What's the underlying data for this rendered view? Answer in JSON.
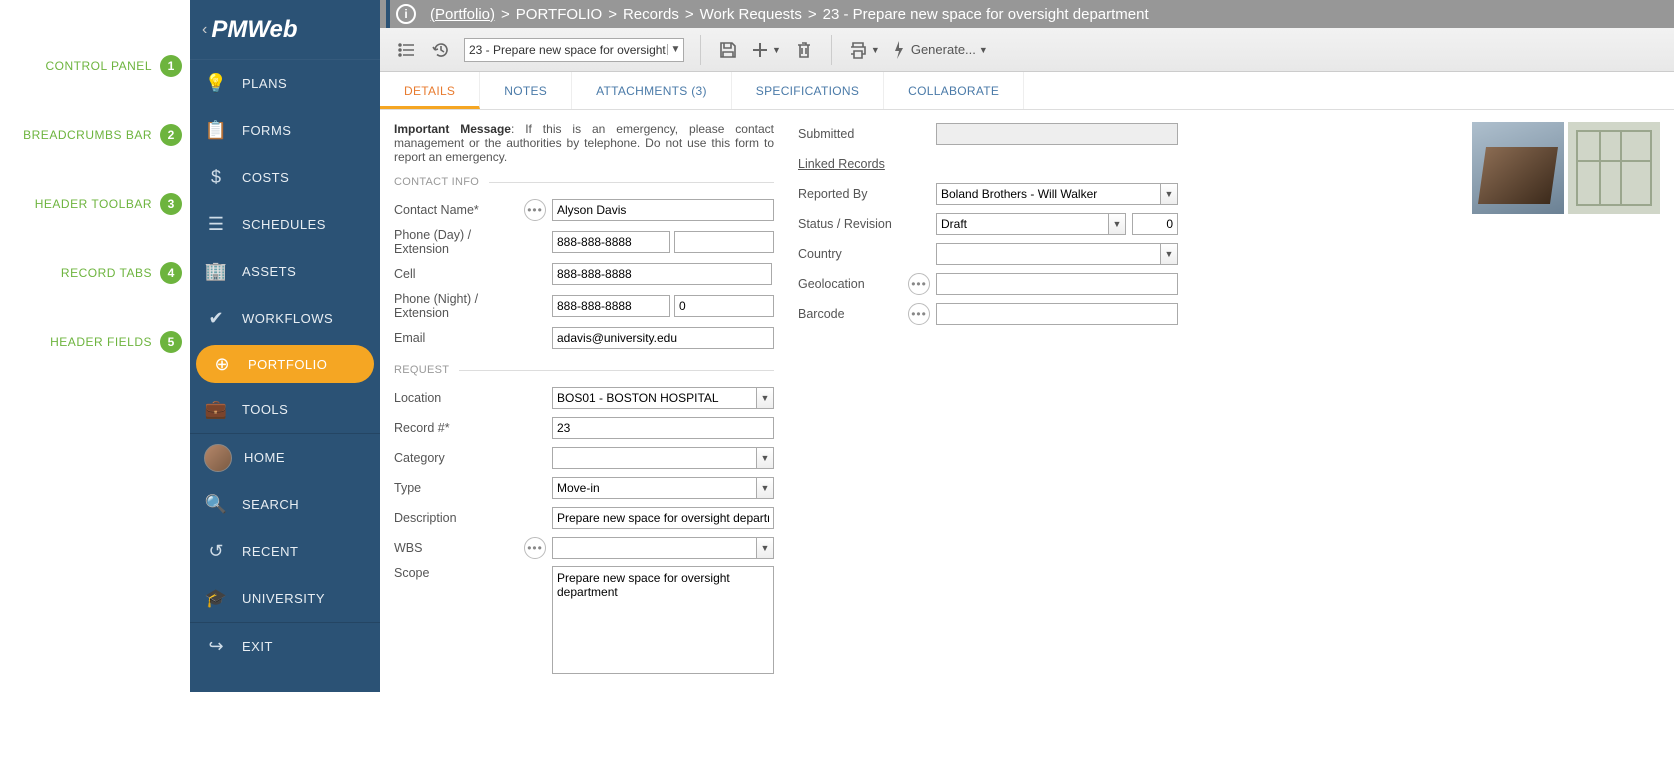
{
  "annotations": [
    {
      "num": "1",
      "label": "CONTROL PANEL"
    },
    {
      "num": "2",
      "label": "BREADCRUMBS BAR"
    },
    {
      "num": "3",
      "label": "HEADER TOOLBAR"
    },
    {
      "num": "4",
      "label": "RECORD TABS"
    },
    {
      "num": "5",
      "label": "HEADER FIELDS"
    }
  ],
  "logo_text": "PMWeb",
  "sidebar": {
    "items": [
      {
        "label": "PLANS",
        "icon": "💡"
      },
      {
        "label": "FORMS",
        "icon": "📋"
      },
      {
        "label": "COSTS",
        "icon": "$"
      },
      {
        "label": "SCHEDULES",
        "icon": "☰"
      },
      {
        "label": "ASSETS",
        "icon": "🏢"
      },
      {
        "label": "WORKFLOWS",
        "icon": "✔"
      },
      {
        "label": "PORTFOLIO",
        "icon": "⊕",
        "active": true
      },
      {
        "label": "TOOLS",
        "icon": "💼"
      }
    ],
    "secondary": [
      {
        "label": "HOME",
        "avatar": true
      },
      {
        "label": "SEARCH",
        "icon": "🔍"
      },
      {
        "label": "RECENT",
        "icon": "↺"
      },
      {
        "label": "UNIVERSITY",
        "icon": "🎓"
      }
    ],
    "exit": {
      "label": "EXIT",
      "icon": "↪"
    }
  },
  "breadcrumb": {
    "link": "(Portfolio)",
    "path": [
      "PORTFOLIO",
      "Records",
      "Work Requests",
      "23 - Prepare new space for oversight department"
    ]
  },
  "toolbar": {
    "record_selector": "23 - Prepare new space for oversight",
    "generate_label": "Generate..."
  },
  "tabs": [
    {
      "label": "DETAILS",
      "active": true
    },
    {
      "label": "NOTES"
    },
    {
      "label": "ATTACHMENTS (3)"
    },
    {
      "label": "SPECIFICATIONS"
    },
    {
      "label": "COLLABORATE"
    }
  ],
  "form": {
    "important_bold": "Important Message",
    "important_text": ": If this is an emergency, please contact management or the authorities by telephone. Do not use this form to report an emergency.",
    "section_contact": "CONTACT INFO",
    "section_request": "REQUEST",
    "contact_name_label": "Contact Name*",
    "contact_name": "Alyson Davis",
    "phone_day_label": "Phone (Day) / Extension",
    "phone_day": "888-888-8888",
    "phone_day_ext": "",
    "cell_label": "Cell",
    "cell": "888-888-8888",
    "phone_night_label": "Phone (Night) / Extension",
    "phone_night": "888-888-8888",
    "phone_night_ext": "0",
    "email_label": "Email",
    "email": "adavis@university.edu",
    "location_label": "Location",
    "location": "BOS01 - BOSTON HOSPITAL",
    "record_label": "Record #*",
    "record": "23",
    "category_label": "Category",
    "category": "",
    "type_label": "Type",
    "type": "Move-in",
    "description_label": "Description",
    "description": "Prepare new space for oversight department",
    "wbs_label": "WBS",
    "wbs": "",
    "scope_label": "Scope",
    "scope": "Prepare new space for oversight department",
    "submitted_label": "Submitted",
    "submitted": "",
    "linked_label": "Linked Records",
    "reported_by_label": "Reported By",
    "reported_by": "Boland Brothers - Will Walker",
    "status_label": "Status / Revision",
    "status": "Draft",
    "revision": "0",
    "country_label": "Country",
    "country": "",
    "geo_label": "Geolocation",
    "geo": "",
    "barcode_label": "Barcode",
    "barcode": ""
  }
}
